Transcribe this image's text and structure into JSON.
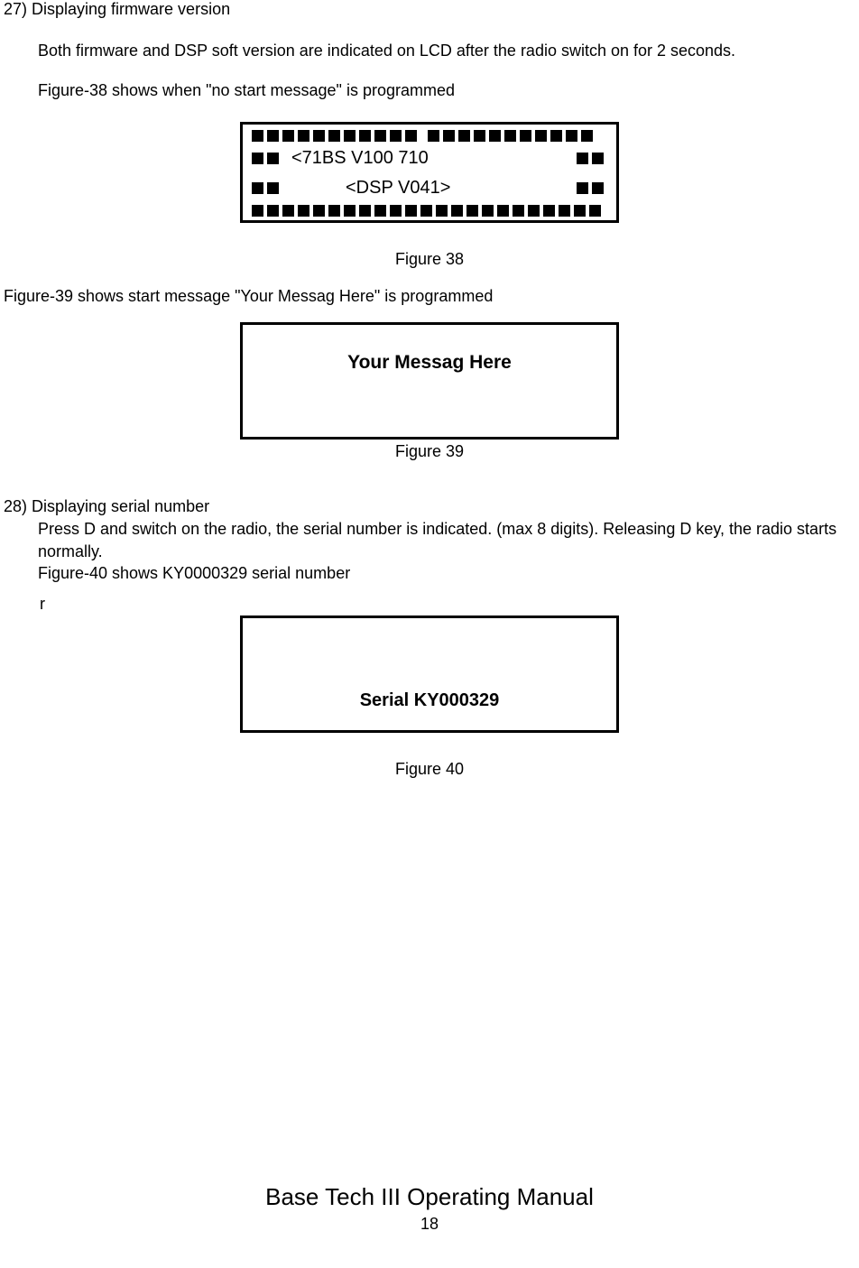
{
  "section27": {
    "heading": "27) Displaying firmware version",
    "p1": "Both firmware and DSP soft version are indicated on LCD after the radio switch on for 2 seconds.",
    "p2": "Figure-38 shows when \"no start message\" is programmed"
  },
  "figure38": {
    "line1": "<71BS    V100   710",
    "line2": "<DSP V041>",
    "caption": "Figure 38"
  },
  "between": "Figure-39 shows start message \"Your Messag Here\" is programmed",
  "figure39": {
    "text": "Your Messag Here",
    "caption": "Figure 39"
  },
  "section28": {
    "heading": "28) Displaying serial number",
    "p1": "Press D and switch on the radio, the serial number is indicated. (max 8 digits). Releasing D key, the radio starts normally.",
    "p2": "Figure-40 shows KY0000329 serial number",
    "stray": "r"
  },
  "figure40": {
    "text": "Serial   KY000329",
    "caption": "Figure 40"
  },
  "footer": {
    "title": "Base Tech III Operating Manual",
    "page": "18"
  }
}
